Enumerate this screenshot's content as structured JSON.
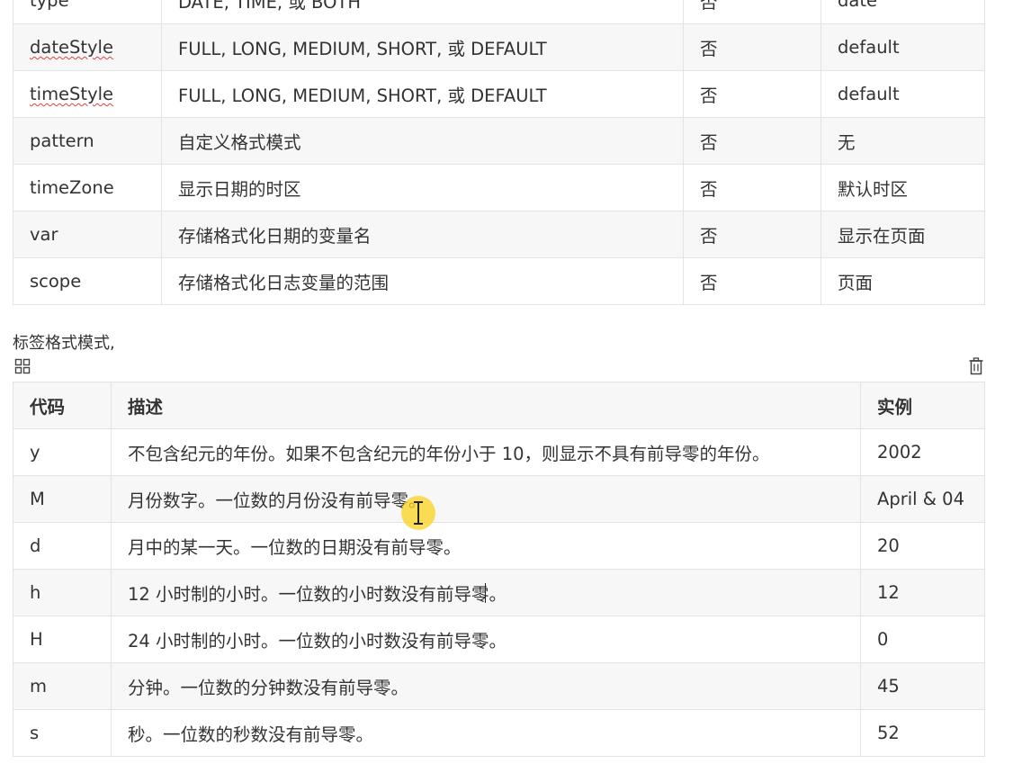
{
  "attr_table": {
    "rows": [
      {
        "name": "type",
        "desc": "DATE, TIME, 或 BOTH",
        "required": "否",
        "default": "date"
      },
      {
        "name": "dateStyle",
        "desc": "FULL, LONG, MEDIUM, SHORT, 或 DEFAULT",
        "required": "否",
        "default": "default"
      },
      {
        "name": "timeStyle",
        "desc": "FULL, LONG, MEDIUM, SHORT, 或 DEFAULT",
        "required": "否",
        "default": "default"
      },
      {
        "name": "pattern",
        "desc": "自定义格式模式",
        "required": "否",
        "default": "无"
      },
      {
        "name": "timeZone",
        "desc": "显示日期的时区",
        "required": "否",
        "default": "默认时区"
      },
      {
        "name": "var",
        "desc": "存储格式化日期的变量名",
        "required": "否",
        "default": "显示在页面"
      },
      {
        "name": "scope",
        "desc": "存储格式化日志变量的范围",
        "required": "否",
        "default": "页面"
      }
    ]
  },
  "caption": "标签格式模式,",
  "icons": {
    "grid": "grid-icon",
    "trash": "trash-icon",
    "cursor": "ibeam-cursor-icon"
  },
  "colors": {
    "highlight": "#fad21e",
    "border": "#e3e3e3",
    "row_alt": "#f7f7f7",
    "spellcheck": "#e04040"
  },
  "pattern_table": {
    "headers": {
      "code": "代码",
      "desc": "描述",
      "example": "实例"
    },
    "rows": [
      {
        "code": "y",
        "desc": "不包含纪元的年份。如果不包含纪元的年份小于 10，则显示不具有前导零的年份。",
        "example": "2002"
      },
      {
        "code": "M",
        "desc": "月份数字。一位数的月份没有前导零。",
        "example": "April & 04"
      },
      {
        "code": "d",
        "desc": "月中的某一天。一位数的日期没有前导零。",
        "example": "20"
      },
      {
        "code": "h",
        "desc": "12 小时制的小时。一位数的小时数没有前导零。",
        "example": "12"
      },
      {
        "code": "H",
        "desc": "24 小时制的小时。一位数的小时数没有前导零。",
        "example": "0"
      },
      {
        "code": "m",
        "desc": "分钟。一位数的分钟数没有前导零。",
        "example": "45"
      },
      {
        "code": "s",
        "desc": "秒。一位数的秒数没有前导零。",
        "example": "52"
      }
    ]
  }
}
